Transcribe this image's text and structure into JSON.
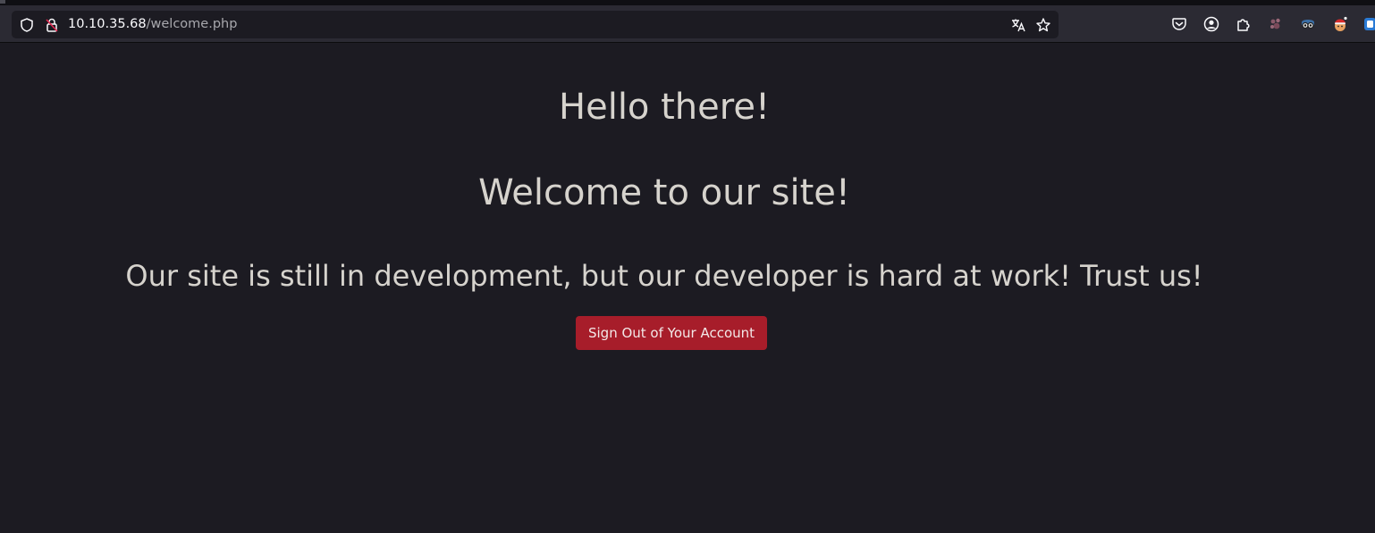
{
  "browser": {
    "url_host": "10.10.35.68",
    "url_path": "/welcome.php",
    "icons": [
      "shield-icon",
      "insecure-lock-icon",
      "translate-icon",
      "bookmark-star-icon",
      "pocket-icon",
      "account-icon",
      "extensions-icon",
      "extension-paw-icon",
      "extension-goggles-icon",
      "extension-santa-icon",
      "extension-partial-icon"
    ]
  },
  "page": {
    "greeting": "Hello there!",
    "welcome": "Welcome to our site!",
    "message": "Our site is still in development, but our developer is hard at work! Trust us!",
    "signout_label": "Sign Out of Your Account"
  },
  "colors": {
    "background": "#1c1b22",
    "text": "#d6d3cd",
    "signout_button": "#a71d2a"
  }
}
